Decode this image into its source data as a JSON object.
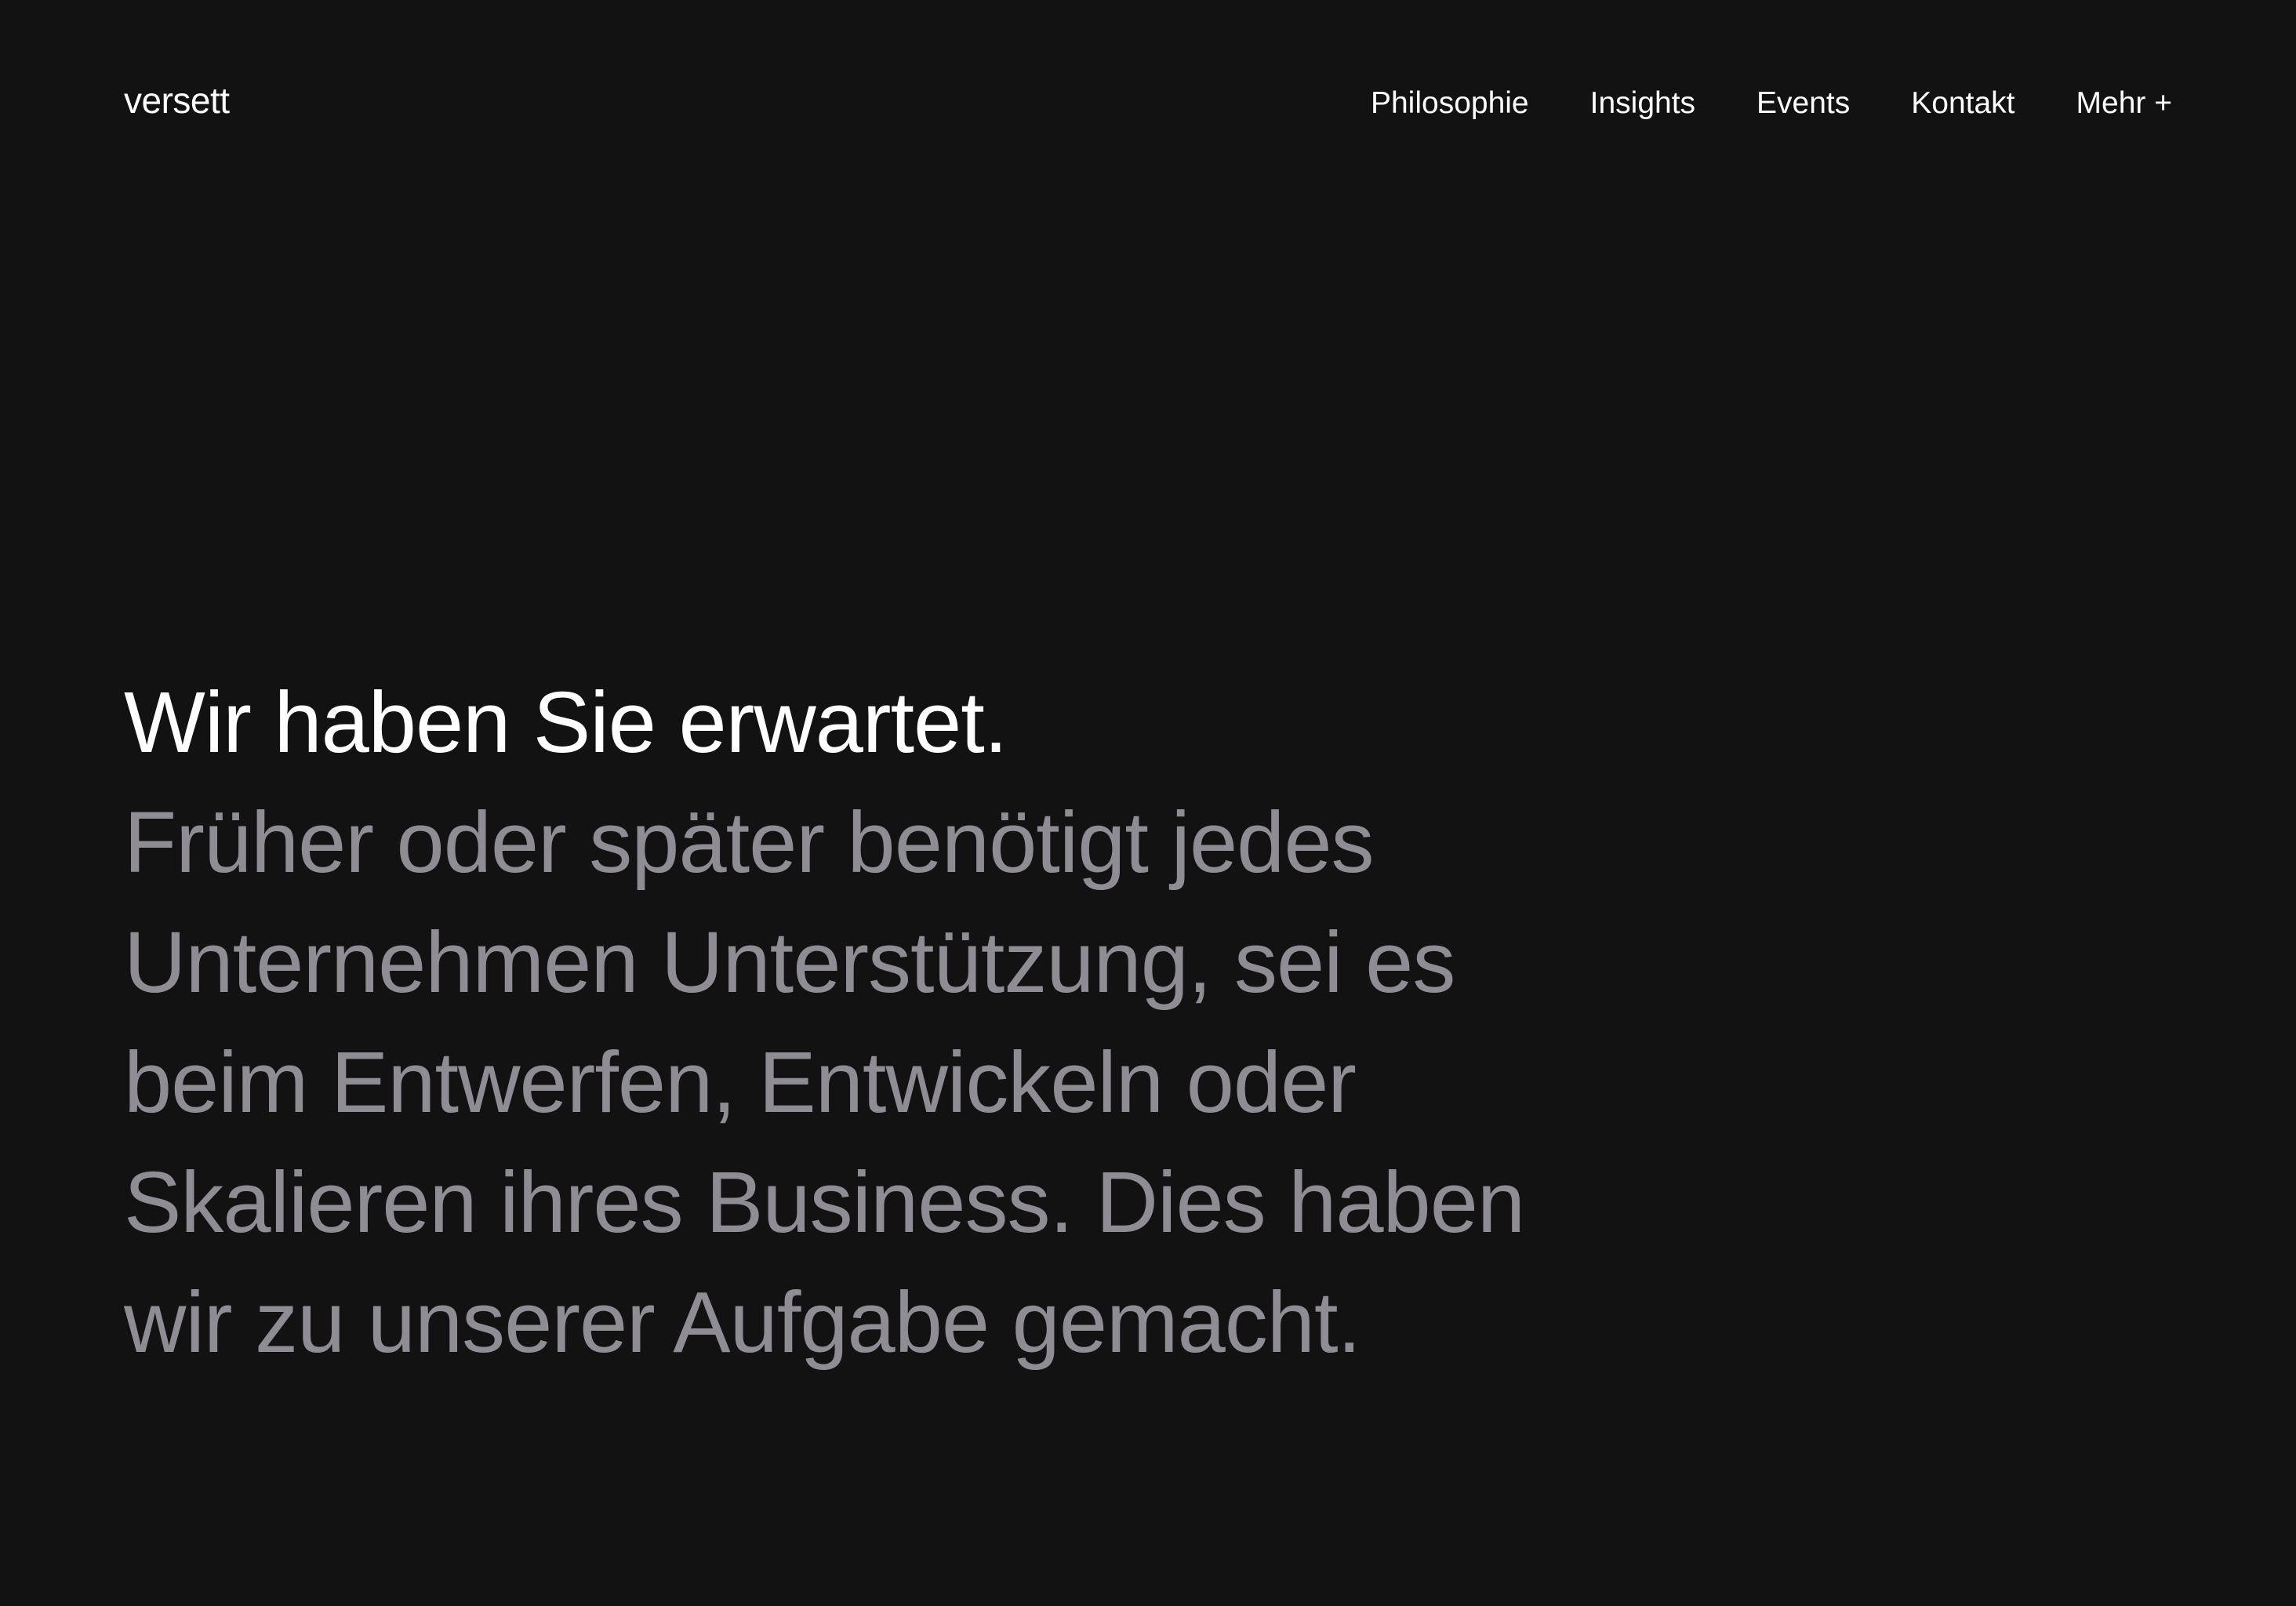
{
  "header": {
    "logo": "versett",
    "nav": [
      {
        "label": "Philosophie"
      },
      {
        "label": "Insights"
      },
      {
        "label": "Events"
      },
      {
        "label": "Kontakt"
      },
      {
        "label": "Mehr +"
      }
    ]
  },
  "hero": {
    "headline": "Wir haben Sie erwartet.",
    "body_lines": [
      "Früher oder später benötigt jedes",
      "Unternehmen Unterstützung, sei es",
      "beim Entwerfen, Entwickeln oder",
      "Skalieren ihres Business. Dies haben",
      "wir zu unserer Aufgabe gemacht."
    ]
  },
  "colors": {
    "background": "#121212",
    "text_primary": "#ffffff",
    "text_secondary": "#8f8c93"
  }
}
